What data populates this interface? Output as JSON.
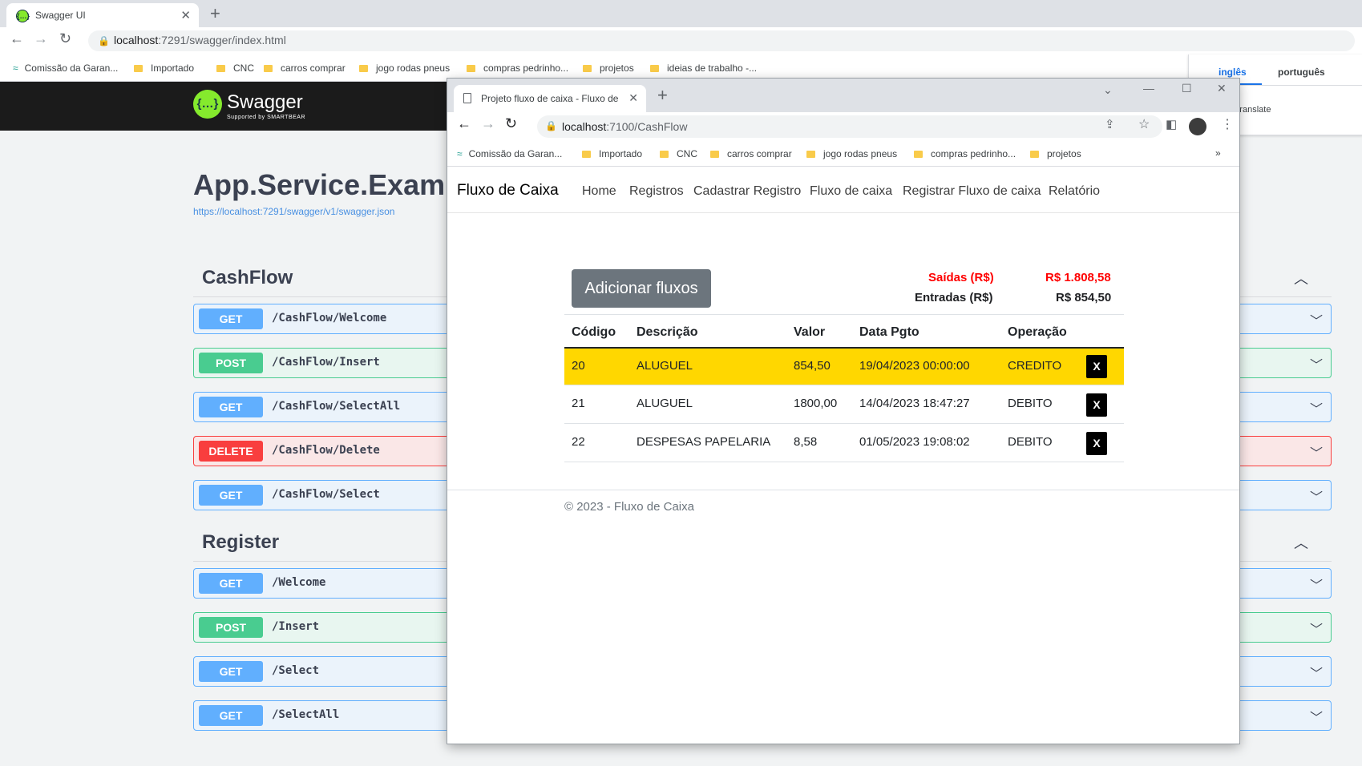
{
  "back_browser": {
    "tab_title": "Swagger UI",
    "favicon_glyph": "{…}",
    "new_tab": "+",
    "url_host": "localhost",
    "url_rest": ":7291/swagger/index.html",
    "bookmarks": [
      "Comissão da Garan...",
      "Importado",
      "CNC",
      "carros comprar",
      "jogo rodas pneus",
      "compras pedrinho...",
      "projetos",
      "ideias de trabalho -..."
    ]
  },
  "swagger": {
    "logo_glyph": "{…}",
    "logo_text": "Swagger",
    "logo_sub": "Supported by SMARTBEAR",
    "title": "App.Service.Exam",
    "json_link": "https://localhost:7291/swagger/v1/swagger.json",
    "sections": [
      {
        "title": "CashFlow",
        "ops": [
          {
            "method": "GET",
            "path": "/CashFlow/Welcome"
          },
          {
            "method": "POST",
            "path": "/CashFlow/Insert"
          },
          {
            "method": "GET",
            "path": "/CashFlow/SelectAll"
          },
          {
            "method": "DELETE",
            "path": "/CashFlow/Delete"
          },
          {
            "method": "GET",
            "path": "/CashFlow/Select"
          }
        ]
      },
      {
        "title": "Register",
        "ops": [
          {
            "method": "GET",
            "path": "/Welcome"
          },
          {
            "method": "POST",
            "path": "/Insert"
          },
          {
            "method": "GET",
            "path": "/Select"
          },
          {
            "method": "GET",
            "path": "/SelectAll"
          }
        ]
      }
    ]
  },
  "translate": {
    "lang1": "inglês",
    "lang2": "português",
    "label": "Translate"
  },
  "front_browser": {
    "tab_title": "Projeto fluxo de caixa - Fluxo de",
    "url_host": "localhost",
    "url_rest": ":7100/CashFlow",
    "bookmarks": [
      "Comissão da Garan...",
      "Importado",
      "CNC",
      "carros comprar",
      "jogo rodas pneus",
      "compras pedrinho...",
      "projetos"
    ],
    "more": "»"
  },
  "site": {
    "brand": "Fluxo de Caixa",
    "nav": [
      "Home",
      "Registros",
      "Cadastrar Registro",
      "Fluxo de caixa",
      "Registrar Fluxo de caixa",
      "Relatório"
    ],
    "add_button": "Adicionar fluxos",
    "saidas_label": "Saídas (R$)",
    "saidas_value": "R$ 1.808,58",
    "entradas_label": "Entradas (R$)",
    "entradas_value": "R$ 854,50",
    "headers": [
      "Código",
      "Descrição",
      "Valor",
      "Data Pgto",
      "Operação"
    ],
    "rows": [
      {
        "codigo": "20",
        "descricao": "ALUGUEL",
        "valor": "854,50",
        "data": "19/04/2023 00:00:00",
        "operacao": "CREDITO",
        "delete": "X"
      },
      {
        "codigo": "21",
        "descricao": "ALUGUEL",
        "valor": "1800,00",
        "data": "14/04/2023 18:47:27",
        "operacao": "DEBITO",
        "delete": "X"
      },
      {
        "codigo": "22",
        "descricao": "DESPESAS PAPELARIA",
        "valor": "8,58",
        "data": "01/05/2023 19:08:02",
        "operacao": "DEBITO",
        "delete": "X"
      }
    ],
    "highlight_color": "#ffd700",
    "footer": "© 2023 - Fluxo de Caixa"
  }
}
